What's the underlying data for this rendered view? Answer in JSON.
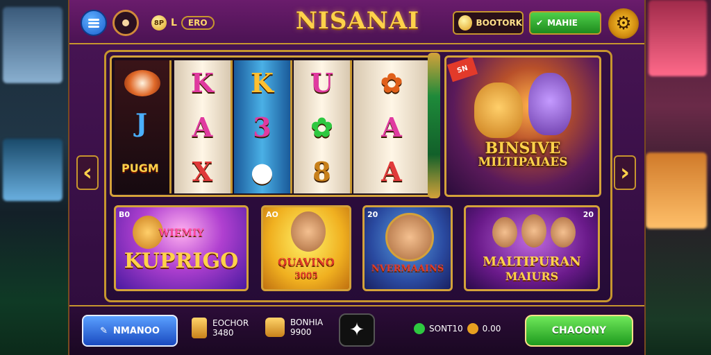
{
  "header": {
    "title": "NISANAI",
    "currency_symbol": "8P",
    "currency_label": "L",
    "currency_pill": "ERO",
    "balance": "BOOTORK",
    "wallet_label": "MAHIE"
  },
  "slot": {
    "left_top_label": "J",
    "left_logo": "PUGM",
    "reels": [
      [
        "K",
        "A",
        "X"
      ],
      [
        "K",
        "3",
        "●"
      ],
      [
        "U",
        "✿",
        "8"
      ],
      [
        "✿",
        "A",
        "A"
      ]
    ]
  },
  "featured": {
    "badge": "SN",
    "title_line1": "BINSIVE",
    "title_line2": "MILTIPAIAES"
  },
  "cards": [
    {
      "tag": "B0",
      "title": "KUPRIGO",
      "subtitle": "WIEMIY"
    },
    {
      "tag": "AO",
      "title": "QUAVINO",
      "subtitle": "3005"
    },
    {
      "tag": "20",
      "title": "NVERMAAINS",
      "subtitle": ""
    },
    {
      "tag": "20",
      "title": "MALTIPURAN",
      "subtitle": "MAIURS"
    }
  ],
  "bottom": {
    "left_button": "NMANOO",
    "stat1_line1": "EOCHOR",
    "stat1_line2": "3480",
    "stat2_line1": "BONHIA",
    "stat2_line2": "9900",
    "prize_text": "SONT10",
    "prize_tail": "0.00",
    "right_button": "CHAOONY",
    "center_icon": "✦"
  },
  "colors": {
    "accent_gold": "#c7962e",
    "panel_purple": "#4a1556",
    "button_green": "#1e9a1e",
    "button_blue": "#1a4ac0"
  },
  "icons": [
    "menu-icon",
    "target-icon",
    "coin-icon",
    "gear-icon",
    "arrow-left-icon",
    "arrow-right-icon",
    "joystick-icon",
    "diamond-icon"
  ]
}
